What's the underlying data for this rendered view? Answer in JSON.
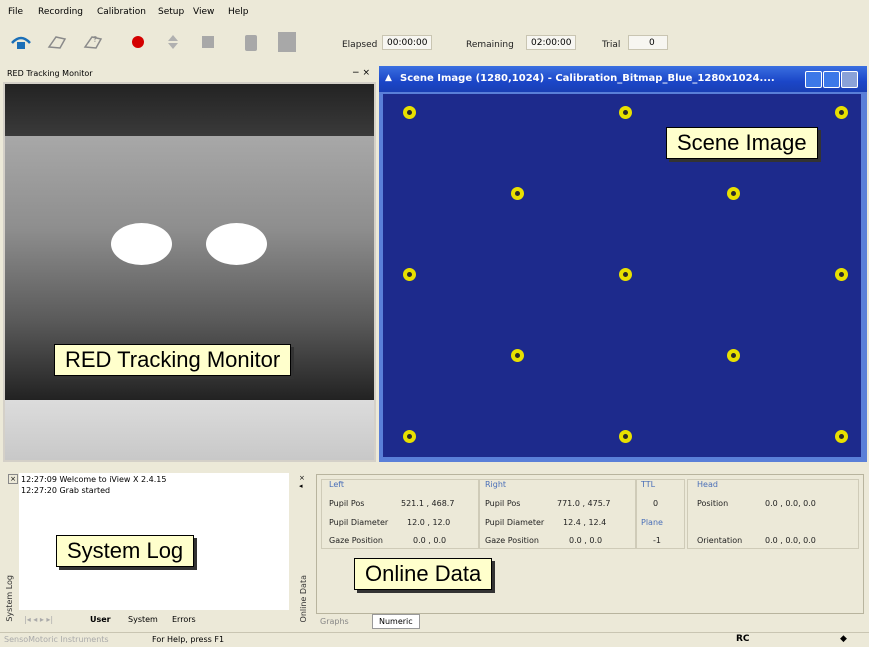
{
  "menu": [
    "File",
    "Recording",
    "Calibration",
    "Setup",
    "View",
    "Help"
  ],
  "toolbar": {
    "icons": [
      "connect-icon",
      "calibrate-icon",
      "validate-icon",
      "record-icon",
      "pause-icon",
      "stop-icon",
      "hand-icon",
      "notes-icon"
    ],
    "elapsed_label": "Elapsed",
    "elapsed_value": "00:00:00",
    "remaining_label": "Remaining",
    "remaining_value": "02:00:00",
    "trial_label": "Trial",
    "trial_value": "0",
    "record_color": "#d40000"
  },
  "tracking_monitor": {
    "title": "RED Tracking Monitor",
    "controls": "− ×",
    "callout": "RED Tracking Monitor"
  },
  "scene": {
    "title": "Scene Image (1280,1024) - Calibration_Bitmap_Blue_1280x1024....",
    "callout": "Scene Image",
    "background": "#1d2a8c",
    "dot_color": "#e8e000"
  },
  "system_log": {
    "entries": [
      {
        "time": "12:27:09",
        "text": "Welcome to iView X 2.4.15"
      },
      {
        "time": "12:27:20",
        "text": "Grab started"
      }
    ],
    "side_label": "System Log",
    "callout": "System Log",
    "tabs": [
      "User",
      "System",
      "Errors"
    ]
  },
  "online_data": {
    "side_label": "Online Data",
    "callout": "Online Data",
    "left": {
      "header": "Left",
      "pupil_pos_label": "Pupil Pos",
      "pupil_pos": "521.1 , 468.7",
      "pupil_diam_label": "Pupil Diameter",
      "pupil_diam": "12.0 , 12.0",
      "gaze_label": "Gaze Position",
      "gaze": "0.0 , 0.0"
    },
    "right": {
      "header": "Right",
      "pupil_pos_label": "Pupil Pos",
      "pupil_pos": "771.0 , 475.7",
      "pupil_diam_label": "Pupil Diameter",
      "pupil_diam": "12.4 , 12.4",
      "gaze_label": "Gaze Position",
      "gaze": "0.0 , 0.0"
    },
    "ttl": {
      "header": "TTL",
      "value": "0"
    },
    "plane": {
      "header": "Plane",
      "value": "-1"
    },
    "head": {
      "header": "Head",
      "position_label": "Position",
      "position": "0.0 , 0.0, 0.0",
      "orientation_label": "Orientation",
      "orientation": "0.0 , 0.0, 0.0"
    },
    "tabs": [
      "Graphs",
      "Numeric"
    ]
  },
  "statusbar": {
    "left": "SensoMotoric Instruments",
    "help": "For Help, press F1",
    "right": "RC"
  }
}
